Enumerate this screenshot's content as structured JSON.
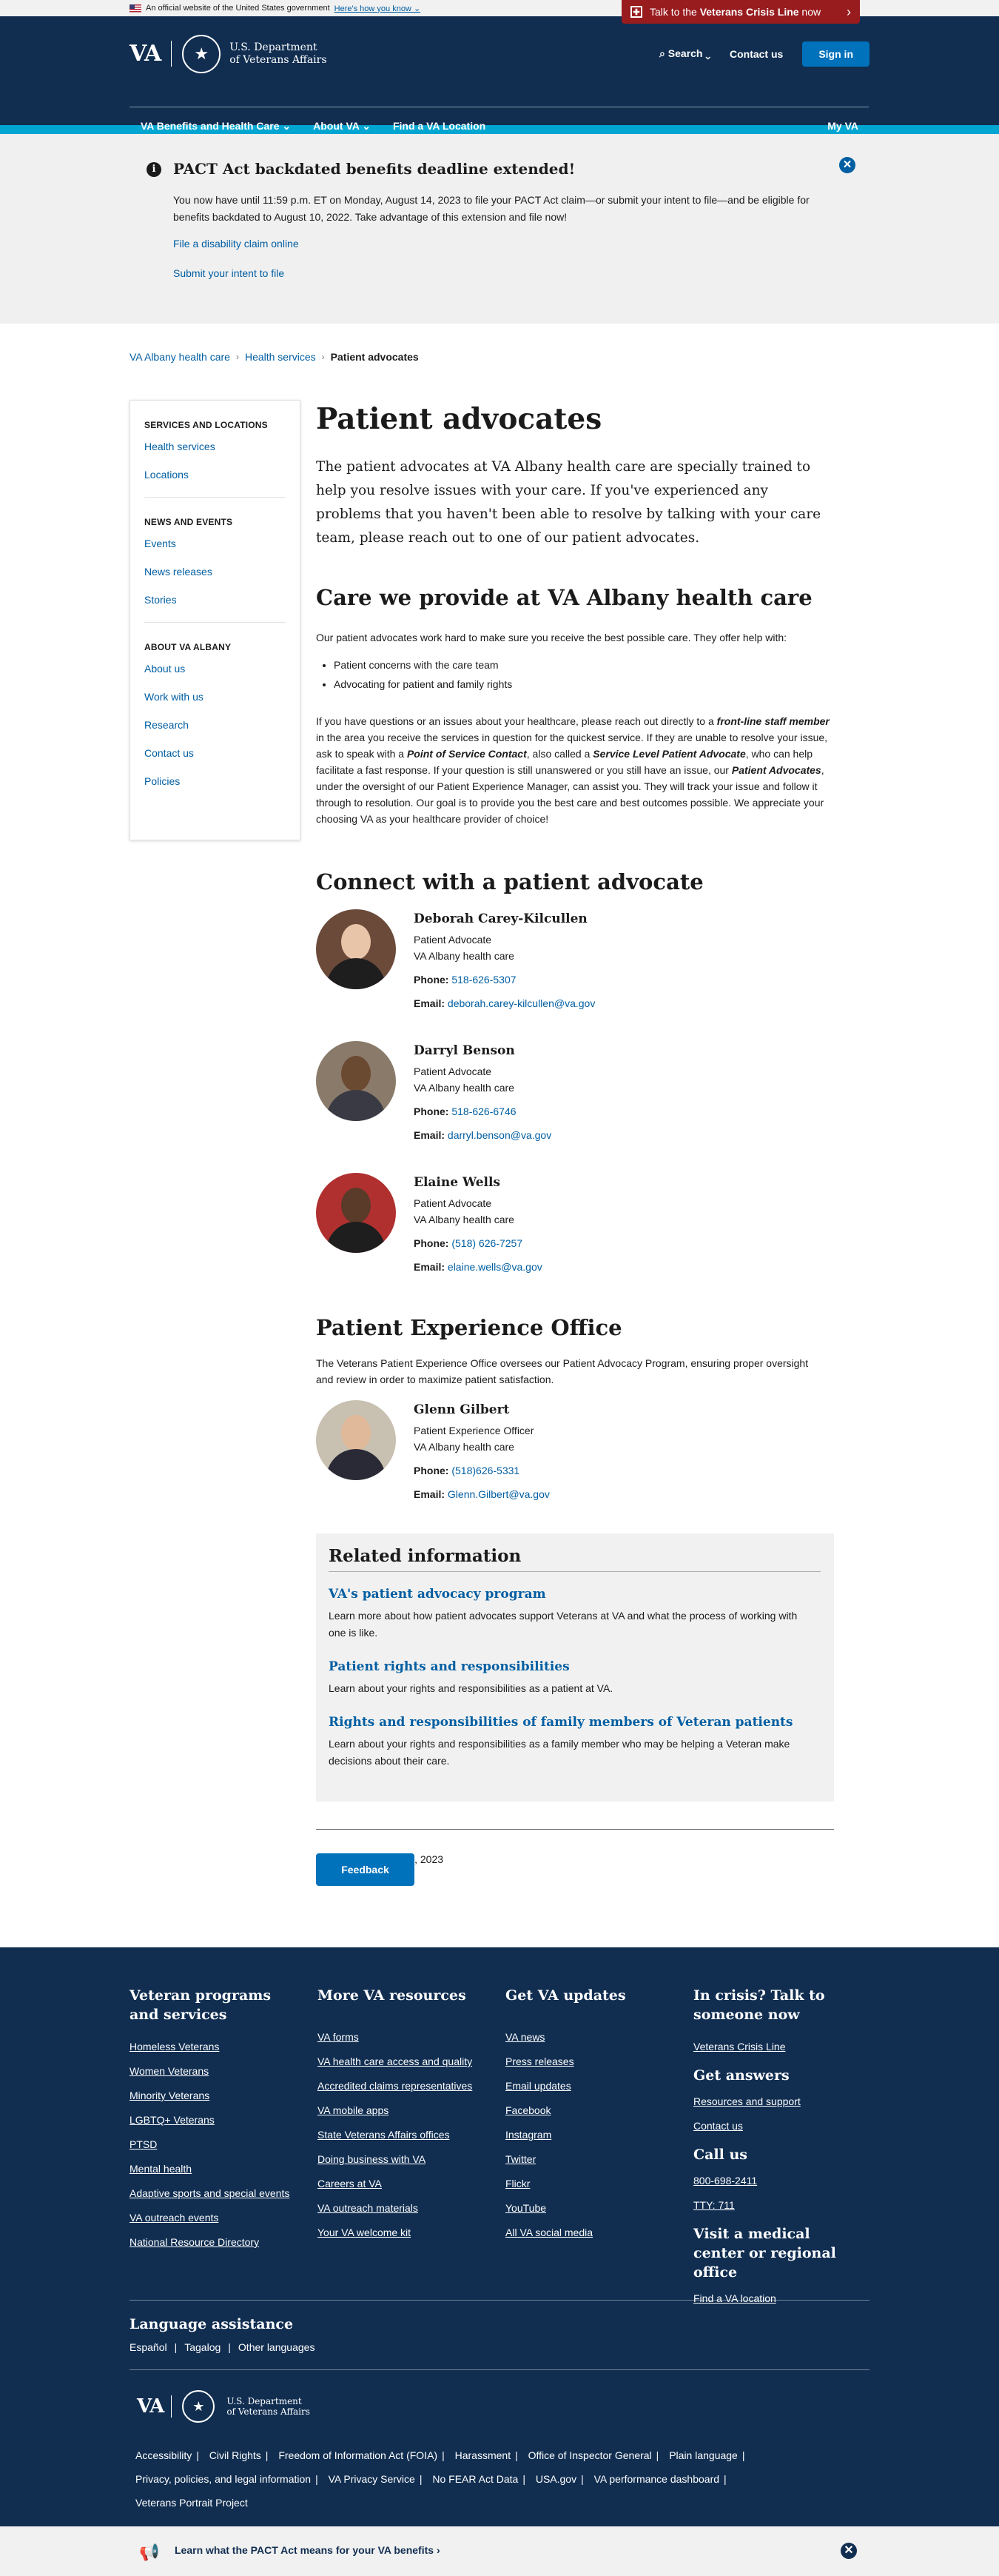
{
  "official_banner": {
    "text": "An official website of the United States government",
    "link": "Here's how you know"
  },
  "crisis_line": {
    "prefix": "Talk to the ",
    "bold": "Veterans Crisis Line",
    "suffix": " now"
  },
  "header": {
    "logo": "VA",
    "dept_line1": "U.S. Department",
    "dept_line2": "of Veterans Affairs",
    "search": "Search",
    "contact": "Contact us",
    "signin": "Sign in",
    "nav": [
      "VA Benefits and Health Care",
      "About VA",
      "Find a VA Location"
    ],
    "myva": "My VA"
  },
  "alert": {
    "title": "PACT Act backdated benefits deadline extended!",
    "body": "You now have until 11:59 p.m. ET on Monday, August 14, 2023 to file your PACT Act claim—or submit your intent to file—and be eligible for benefits backdated to August 10, 2022. Take advantage of this extension and file now!",
    "link1": "File a disability claim online",
    "link2": "Submit your intent to file"
  },
  "breadcrumbs": [
    "VA Albany health care",
    "Health services",
    "Patient advocates"
  ],
  "sidebar": {
    "sections": [
      {
        "title": "SERVICES AND LOCATIONS",
        "items": [
          "Health services",
          "Locations"
        ]
      },
      {
        "title": "NEWS AND EVENTS",
        "items": [
          "Events",
          "News releases",
          "Stories"
        ]
      },
      {
        "title": "ABOUT VA ALBANY",
        "items": [
          "About us",
          "Work with us",
          "Research",
          "Contact us",
          "Policies"
        ]
      }
    ]
  },
  "main": {
    "title": "Patient advocates",
    "lead": "The patient advocates at VA Albany health care are specially trained to help you resolve issues with your care. If you've experienced any problems that you haven't been able to resolve by talking with your care team, please reach out to one of our patient advocates.",
    "care_heading": "Care we provide at VA Albany health care",
    "care_intro": "Our patient advocates work hard to make sure you receive the best possible care. They offer help with:",
    "care_items": [
      "Patient concerns with the care team",
      "Advocating for patient and family rights"
    ],
    "care_p": {
      "t1": "If you have questions or an issues about your healthcare, please reach out directly to a ",
      "b1": "front-line staff member",
      "t2": " in the area you receive the services in question for the quickest service.  If they are unable to resolve your issue, ask to speak with a ",
      "b2": "Point of Service Contact",
      "t3": ", also called a ",
      "b3": "Service Level Patient Advocate",
      "t4": ", who can  help facilitate a fast response.  If your question is still unanswered or you still have an issue, our ",
      "b4": "Patient Advocates",
      "t5": ", under the oversight of our Patient Experience Manager, can assist you.  They will track your issue and follow it through to resolution.  Our goal is to provide you the best care and best outcomes possible.  We appreciate your choosing VA as your healthcare provider of choice!"
    },
    "connect_heading": "Connect with a patient advocate",
    "phone_label": "Phone:",
    "email_label": "Email:",
    "advocates": [
      {
        "name": "Deborah Carey-Kilcullen",
        "role": "Patient Advocate",
        "org": "VA Albany health care",
        "phone": "518-626-5307",
        "email": "deborah.carey-kilcullen@va.gov"
      },
      {
        "name": "Darryl Benson",
        "role": "Patient Advocate",
        "org": "VA Albany health care",
        "phone": "518-626-6746",
        "email": "darryl.benson@va.gov"
      },
      {
        "name": "Elaine Wells",
        "role": "Patient Advocate",
        "org": "VA Albany health care",
        "phone": "(518) 626-7257",
        "email": "elaine.wells@va.gov"
      }
    ],
    "pxo_heading": "Patient Experience Office",
    "pxo_text": "The Veterans Patient Experience Office oversees our Patient Advocacy Program, ensuring proper oversight and review in order to maximize patient satisfaction.",
    "pxo_person": {
      "name": "Glenn Gilbert",
      "role": "Patient Experience Officer",
      "org": "VA Albany health care",
      "phone": "(518)626-5331",
      "email": "Glenn.Gilbert@va.gov"
    },
    "related": {
      "heading": "Related information",
      "items": [
        {
          "title": "VA's patient advocacy program",
          "desc": "Learn more about how patient advocates support Veterans at VA and what the process of working with one is like."
        },
        {
          "title": "Patient rights and responsibilities",
          "desc": "Learn about your rights and responsibilities as a patient at VA."
        },
        {
          "title": "Rights and responsibilities of family members of Veteran patients",
          "desc": "Learn about your rights and responsibilities as a family member who may be helping a Veteran make decisions about their care."
        }
      ]
    },
    "last_updated": "Last updated: July 14, 2023",
    "feedback": "Feedback"
  },
  "footer": {
    "col1": {
      "title": "Veteran programs and services",
      "links": [
        "Homeless Veterans",
        "Women Veterans",
        "Minority Veterans",
        "LGBTQ+ Veterans",
        "PTSD",
        "Mental health",
        "Adaptive sports and special events",
        "VA outreach events",
        "National Resource Directory"
      ]
    },
    "col2": {
      "title": "More VA resources",
      "links": [
        "VA forms",
        "VA health care access and quality",
        "Accredited claims representatives",
        "VA mobile apps",
        "State Veterans Affairs offices",
        "Doing business with VA",
        "Careers at VA",
        "VA outreach materials",
        "Your VA welcome kit"
      ]
    },
    "col3": {
      "title": "Get VA updates",
      "links": [
        "VA news",
        "Press releases",
        "Email updates",
        "Facebook",
        "Instagram",
        "Twitter",
        "Flickr",
        "YouTube",
        "All VA social media"
      ]
    },
    "col4": {
      "crisis_title": "In crisis? Talk to someone now",
      "crisis_link": "Veterans Crisis Line",
      "answers_title": "Get answers",
      "answers_links": [
        "Resources and support",
        "Contact us"
      ],
      "call_title": "Call us",
      "call_links": [
        "800-698-2411",
        "TTY: 711"
      ],
      "visit_title": "Visit a medical center or regional office",
      "visit_link": "Find a VA location"
    },
    "language": {
      "title": "Language assistance",
      "links": [
        "Español",
        "Tagalog",
        "Other languages"
      ]
    },
    "bottom_links": [
      "Accessibility",
      "Civil Rights",
      "Freedom of Information Act (FOIA)",
      "Harassment",
      "Office of Inspector General",
      "Plain language",
      "Privacy, policies, and legal information",
      "VA Privacy Service",
      "No FEAR Act Data",
      "USA.gov",
      "VA performance dashboard",
      "Veterans Portrait Project"
    ]
  },
  "promo": {
    "text": "Learn what the PACT Act means for your VA benefits ›"
  },
  "colors": {
    "primary_dark": "#112e51",
    "accent": "#00a6d2",
    "link": "#005ea2",
    "button": "#0071bb",
    "crisis": "#981b1e"
  },
  "icons": [
    "flag-icon",
    "crisis-line-icon",
    "chevron-right-icon",
    "search-icon",
    "chevron-down-icon",
    "info-icon",
    "close-icon",
    "va-seal-icon",
    "megaphone-icon"
  ]
}
